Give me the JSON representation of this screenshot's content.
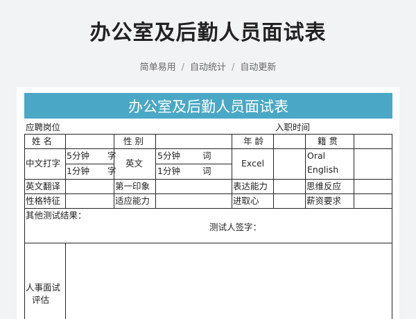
{
  "page": {
    "title": "办公室及后勤人员面试表",
    "subtitle": [
      "简单易用",
      "自动统计",
      "自动更新"
    ],
    "separator": "/"
  },
  "form": {
    "title": "办公室及后勤人员面试表",
    "header": {
      "position_label": "应聘岗位",
      "entry_time_label": "入职时间"
    },
    "row_basic": {
      "name": "姓 名",
      "gender": "性 别",
      "age": "年 龄",
      "origin": "籍 贯"
    },
    "row_skills": {
      "cn_typing": "中文打字",
      "cn_5min": "5分钟",
      "cn_5min_unit": "字",
      "cn_1min": "1分钟",
      "cn_1min_unit": "字",
      "english": "英文",
      "en_5min": "5分钟",
      "en_5min_unit": "词",
      "en_1min": "1分钟",
      "en_1min_unit": "词",
      "excel": "Excel",
      "oral_english_1": "Oral",
      "oral_english_2": "English"
    },
    "row_3": {
      "translation": "英文翻译",
      "first_impression": "第一印象",
      "expression": "表达能力",
      "thinking": "思维反应"
    },
    "row_4": {
      "personality": "性格特征",
      "adaptability": "适应能力",
      "motivation": "进取心",
      "salary": "薪资要求"
    },
    "other_results_label": "其他测试结果：",
    "tester_signature_label": "测试人签字：",
    "hr_interview_label": "人事面试",
    "hr_interview_label_2": "评估"
  }
}
